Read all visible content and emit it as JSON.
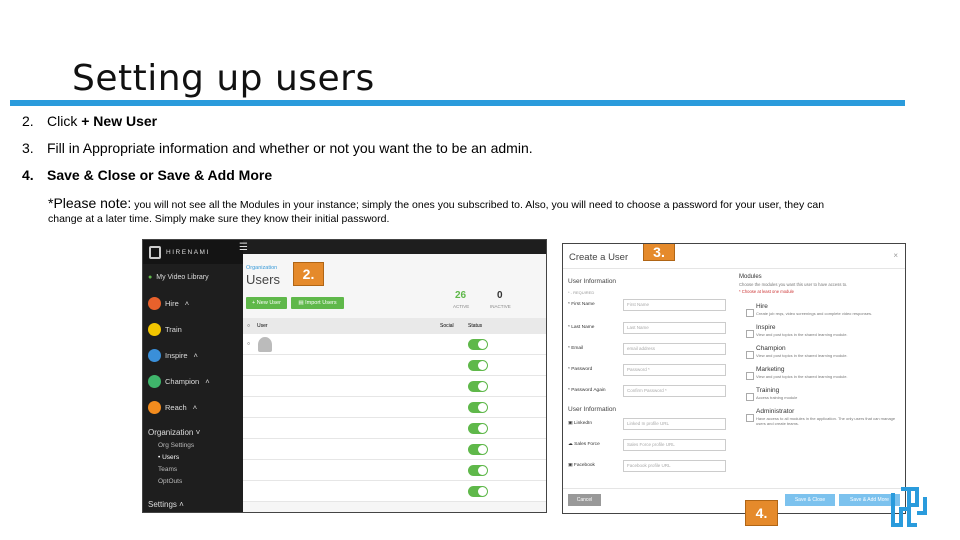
{
  "slide": {
    "title": "Setting up users",
    "steps": [
      {
        "num": "2.",
        "text_plain": "Click ",
        "text_bold": "+ New User"
      },
      {
        "num": "3.",
        "text": "Fill in Appropriate information and whether or not you want the to be an admin."
      },
      {
        "num": "4.",
        "text": "Save & Close or Save & Add More"
      }
    ],
    "note_lead": "*Please note:",
    "note_body": " you will not see all the Modules in your instance; simply the ones you subscribed to. Also, you will need to choose a password for your user, they can change at a later time.  Simply make sure they know their initial password.",
    "accent_color": "#2a9bdc"
  },
  "badges": {
    "b2": "2.",
    "b3": "3.",
    "b4": "4."
  },
  "app": {
    "logo_text": "HIRENAMI",
    "library": "My Video Library",
    "menu": [
      {
        "label": "Hire",
        "suffix": "˄",
        "color": "#e8612c"
      },
      {
        "label": "Train",
        "suffix": "",
        "color": "#f2c500"
      },
      {
        "label": "Inspire",
        "suffix": "˄",
        "color": "#3a8fd9"
      },
      {
        "label": "Champion",
        "suffix": "˄",
        "color": "#3fb56b"
      },
      {
        "label": "Reach",
        "suffix": "˄",
        "color": "#f28c1e"
      }
    ],
    "org_heading": "Organization ˅",
    "org_items": [
      "Org Settings",
      "Users",
      "Teams",
      "OptOuts"
    ],
    "settings": "Settings ˄",
    "breadcrumb": "Organization",
    "page_title": "Users",
    "new_user_btn": "+ New User",
    "import_btn": "Import Users",
    "active_count": "26",
    "active_label": "ACTIVE",
    "inactive_count": "0",
    "inactive_label": "INACTIVE",
    "col_user": "User",
    "col_social": "Social",
    "col_status": "Status",
    "row_count_visible": 8
  },
  "dialog": {
    "title": "Create a User",
    "close": "×",
    "user_info": "User Information",
    "required": "* - REQUIRED",
    "fields": [
      {
        "label": "* First Name",
        "placeholder": "First Name"
      },
      {
        "label": "* Last Name",
        "placeholder": "Last Name"
      },
      {
        "label": "* Email",
        "placeholder": "email address"
      },
      {
        "label": "* Password",
        "placeholder": "Password *"
      },
      {
        "label": "* Password Again",
        "placeholder": "Confirm Password *"
      }
    ],
    "user_info2": "User Information",
    "social": [
      {
        "label": "LinkedIn",
        "placeholder": "Linked In profile URL"
      },
      {
        "label": "Sales Force",
        "placeholder": "Sales Force profile URL"
      },
      {
        "label": "Facebook",
        "placeholder": "Facebook profile URL"
      }
    ],
    "modules_title": "Modules",
    "modules_desc": "Choose the modules you want this user to have access to.",
    "modules_req": "* Choose at least one module",
    "modules": [
      {
        "name": "Hire",
        "desc": "Create job reqs, video screenings and complete video responses."
      },
      {
        "name": "Inspire",
        "desc": "View and post topics in the shared learning module."
      },
      {
        "name": "Champion",
        "desc": "View and post topics in the shared learning module."
      },
      {
        "name": "Marketing",
        "desc": "View and post topics in the shared learning module."
      },
      {
        "name": "Training",
        "desc": "Access training module"
      },
      {
        "name": "Administrator",
        "desc": "Have access to all modules in the application. The only users that can manage users and create teams."
      }
    ],
    "cancel": "Cancel",
    "save_close": "Save & Close",
    "save_add": "Save & Add More"
  }
}
